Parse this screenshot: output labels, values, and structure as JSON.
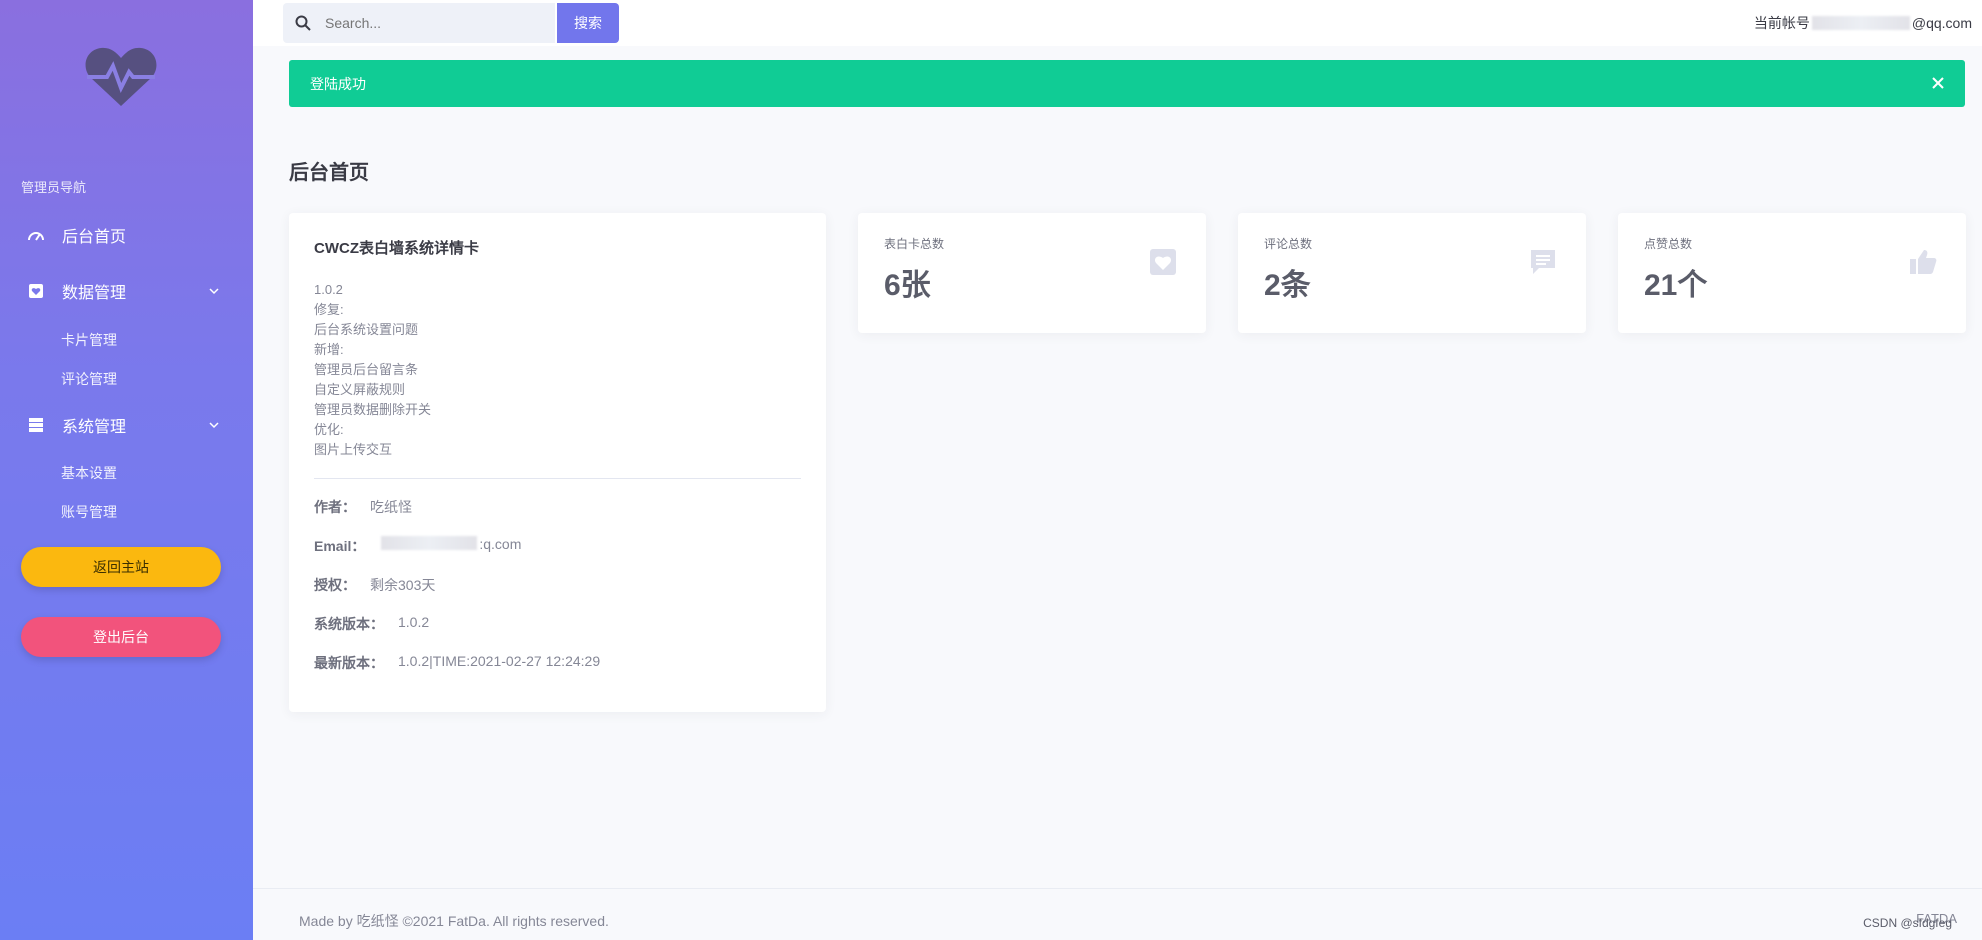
{
  "sidebar": {
    "logo_icon": "heart-pulse-icon",
    "heading": "管理员导航",
    "items": [
      {
        "label": "后台首页",
        "icon": "gauge-icon"
      },
      {
        "label": "数据管理",
        "icon": "heart-box-icon",
        "sub": [
          "卡片管理",
          "评论管理"
        ]
      },
      {
        "label": "系统管理",
        "icon": "list-icon",
        "sub": [
          "基本设置",
          "账号管理"
        ]
      }
    ],
    "home_button": "返回主站",
    "logout_button": "登出后台"
  },
  "topbar": {
    "search_placeholder": "Search...",
    "search_button": "搜索",
    "account_prefix": "当前帐号",
    "account_suffix": "@qq.com"
  },
  "alert": {
    "message": "登陆成功"
  },
  "page_title": "后台首页",
  "detail_card": {
    "title": "CWCZ表白墙系统详情卡",
    "changelog": [
      "1.0.2",
      "修复:",
      "后台系统设置问题",
      "新增:",
      "管理员后台留言条",
      "自定义屏蔽规则",
      "管理员数据删除开关",
      "优化:",
      "图片上传交互"
    ],
    "author_label": "作者：",
    "author_value": "吃纸怪",
    "email_label": "Email：",
    "email_value": ":q.com",
    "license_label": "授权：",
    "license_value": "剩余303天",
    "sysver_label": "系统版本：",
    "sysver_value": "1.0.2",
    "latest_label": "最新版本：",
    "latest_value": "1.0.2|TIME:2021-02-27 12:24:29"
  },
  "stats": [
    {
      "label": "表白卡总数",
      "value": "6张",
      "icon": "heart-icon"
    },
    {
      "label": "评论总数",
      "value": "2条",
      "icon": "comment-icon"
    },
    {
      "label": "点赞总数",
      "value": "21个",
      "icon": "thumbs-up-icon"
    }
  ],
  "footer": {
    "text": "Made by 吃纸怪 ©2021 FatDa. All rights reserved.",
    "right": "FATDA",
    "watermark": "CSDN @sfdgfeg"
  },
  "colors": {
    "primary": "#7276ec",
    "success": "#10cc95",
    "warning": "#fbb80f",
    "danger": "#f2537c"
  }
}
